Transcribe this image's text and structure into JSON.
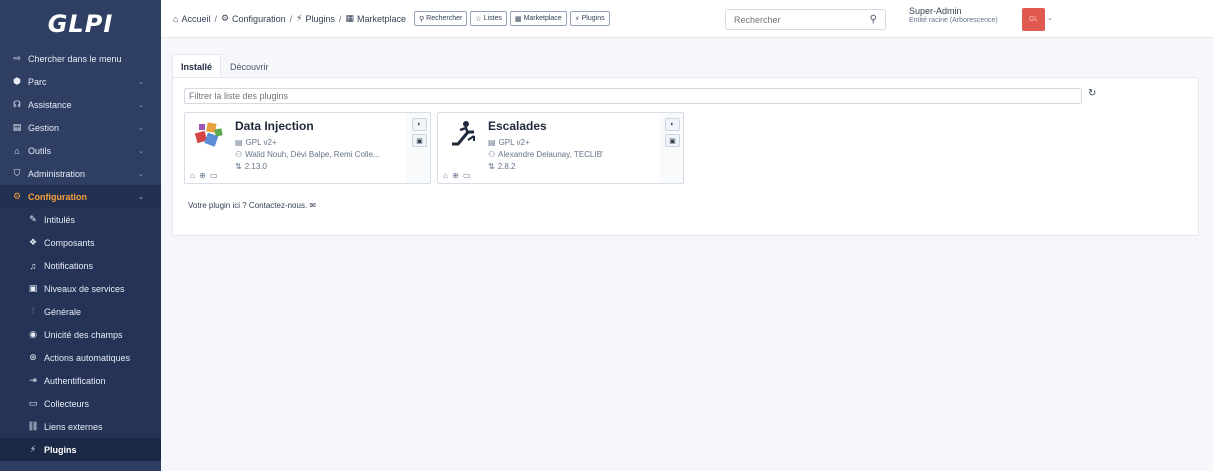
{
  "app": {
    "logo": "GLPI"
  },
  "sidebar": {
    "items": [
      {
        "label": "Chercher dans le menu",
        "icon": "menu-search-icon",
        "glyph": "⇨",
        "chevron": false
      },
      {
        "label": "Parc",
        "icon": "cube-icon",
        "glyph": "⬢",
        "chevron": true
      },
      {
        "label": "Assistance",
        "icon": "headset-icon",
        "glyph": "☊",
        "chevron": true
      },
      {
        "label": "Gestion",
        "icon": "wallet-icon",
        "glyph": "▤",
        "chevron": true
      },
      {
        "label": "Outils",
        "icon": "briefcase-icon",
        "glyph": "⌂",
        "chevron": true
      },
      {
        "label": "Administration",
        "icon": "shield-check-icon",
        "glyph": "⛉",
        "chevron": true
      },
      {
        "label": "Configuration",
        "icon": "settings-icon",
        "glyph": "⚙",
        "chevron": true
      }
    ],
    "subitems": [
      {
        "label": "Intitulés",
        "icon": "edit-icon",
        "glyph": "✎"
      },
      {
        "label": "Composants",
        "icon": "components-icon",
        "glyph": "❖"
      },
      {
        "label": "Notifications",
        "icon": "bell-icon",
        "glyph": "♫"
      },
      {
        "label": "Niveaux de services",
        "icon": "checklist-icon",
        "glyph": "▣"
      },
      {
        "label": "Générale",
        "icon": "adjustments-icon",
        "glyph": "⫶"
      },
      {
        "label": "Unicité des champs",
        "icon": "fingerprint-icon",
        "glyph": "◉"
      },
      {
        "label": "Actions automatiques",
        "icon": "automation-icon",
        "glyph": "⊛"
      },
      {
        "label": "Authentification",
        "icon": "login-icon",
        "glyph": "⇥"
      },
      {
        "label": "Collecteurs",
        "icon": "inbox-icon",
        "glyph": "▭"
      },
      {
        "label": "Liens externes",
        "icon": "link-icon",
        "glyph": "⛓"
      },
      {
        "label": "Plugins",
        "icon": "plug-icon",
        "glyph": "⚡"
      }
    ]
  },
  "header": {
    "breadcrumb": [
      "Accueil",
      "Configuration",
      "Plugins",
      "Marketplace"
    ],
    "quick": [
      "Rechercher",
      "Listes",
      "Marketplace",
      "Plugins"
    ],
    "search_placeholder": "Rechercher",
    "user_name": "Super-Admin",
    "user_entity": "Entité racine (Arborescence)",
    "avatar_initials": "GL"
  },
  "tabs": [
    "Installé",
    "Découvrir"
  ],
  "filter_placeholder": "Filtrer la liste des plugins",
  "plugins": [
    {
      "name": "Data Injection",
      "license": "GPL v2+",
      "authors": "Walid Nouh, Dévi Balpe, Remi Colle...",
      "version": "2.13.0"
    },
    {
      "name": "Escalades",
      "license": "GPL v2+",
      "authors": "Alexandre Delaunay, TECLIB'",
      "version": "2.8.2"
    }
  ],
  "contact_text": "Votre plugin ici ? Contactez-nous."
}
